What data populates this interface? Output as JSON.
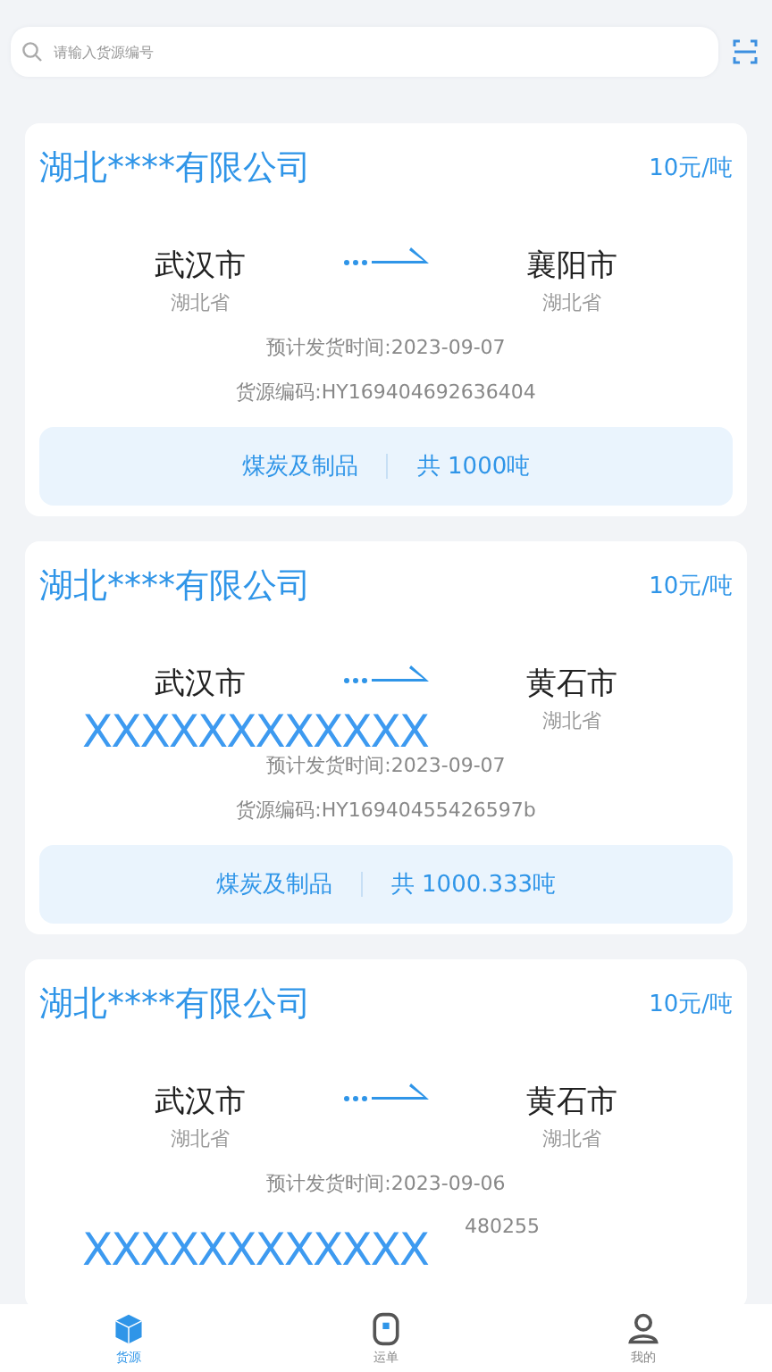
{
  "search": {
    "placeholder": "请输入货源编号"
  },
  "cards": [
    {
      "company": "湖北****有限公司",
      "price": "10元/吨",
      "origin_city": "武汉市",
      "origin_province": "湖北省",
      "dest_city": "襄阳市",
      "dest_province": "湖北省",
      "date": "预计发货时间:2023-09-07",
      "code": "货源编码:HY169404692636404",
      "code_cut": false,
      "goods": "煤炭及制品",
      "amount": "共 1000吨"
    },
    {
      "company": "湖北****有限公司",
      "price": "10元/吨",
      "origin_city": "武汉市",
      "dest_city": "黄石市",
      "dest_province": "湖北省",
      "date": "预计发货时间:2023-09-07",
      "code": "货源编码:HY16940455426597b",
      "code_cut": false,
      "goods": "煤炭及制品",
      "amount": "共 1000.333吨",
      "redaction": "XXXXXXXXXXXX"
    },
    {
      "company": "湖北****有限公司",
      "price": "10元/吨",
      "origin_city": "武汉市",
      "origin_province": "湖北省",
      "dest_city": "黄石市",
      "dest_province": "湖北省",
      "date": "预计发货时间:2023-09-06",
      "code": "480255",
      "code_cut": true,
      "redaction": "XXXXXXXXXXXX"
    }
  ],
  "nav": [
    {
      "label": "货源",
      "selected": true
    },
    {
      "label": "运单",
      "selected": false
    },
    {
      "label": "我的",
      "selected": false
    }
  ]
}
